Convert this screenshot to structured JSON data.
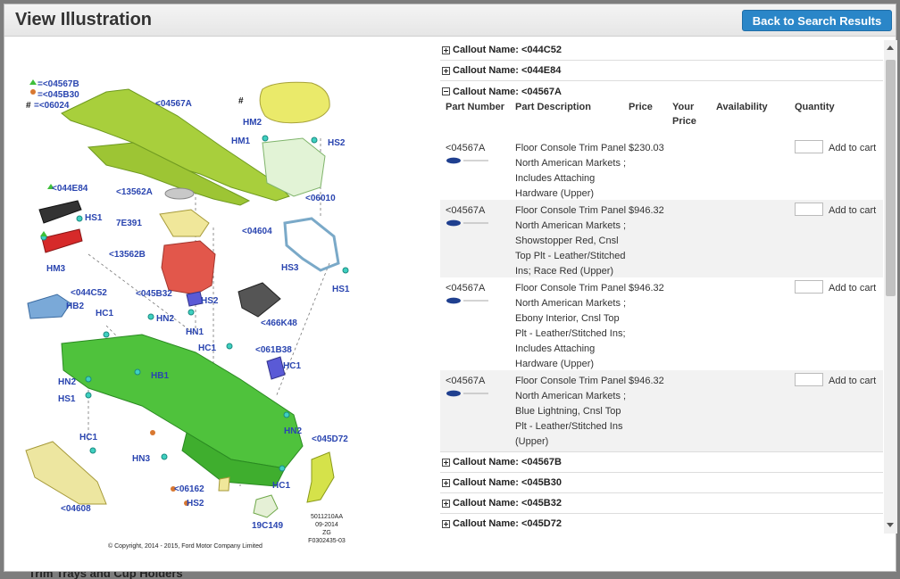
{
  "background_text": "Trim Trays and Cup Holders",
  "modal": {
    "title": "View Illustration",
    "back_button": "Back to Search Results"
  },
  "illustration": {
    "legend": [
      {
        "symbol": "triangle",
        "text": "=<04567B"
      },
      {
        "symbol": "circle",
        "text": "=<045B30"
      },
      {
        "symbol": "#",
        "text": "=<06024"
      }
    ],
    "labels": [
      "<04567A",
      "#",
      "HM2",
      "HM1",
      "HS2",
      "<06010",
      "<044E84",
      "HS1",
      "<13562A",
      "7E391",
      "<04604",
      "<13562B",
      "HM3",
      "<044C52",
      "HB2",
      "<045B32",
      "HS2",
      "HS3",
      "HS1",
      "HC1",
      "HN2",
      "HN1",
      "<466K48",
      "HC1",
      "<061B38",
      "HC1",
      "HB1",
      "HN2",
      "HS1",
      "HC1",
      "HN2",
      "<045D72",
      "HN3",
      "<06162",
      "HS2",
      "HC1",
      "<04608",
      "19C149"
    ],
    "ref_note": [
      "5011210AA",
      "09-2014",
      "ZG",
      "F0302435-03"
    ],
    "copyright": "© Copyright, 2014 - 2015, Ford Motor Company Limited"
  },
  "callouts_top": [
    {
      "label": "Callout Name: <044C52",
      "expanded": false
    },
    {
      "label": "Callout Name: <044E84",
      "expanded": false
    },
    {
      "label": "Callout Name: <04567A",
      "expanded": true
    }
  ],
  "table": {
    "headers": {
      "part_number": "Part Number",
      "part_description": "Part Description",
      "price": "Price",
      "your_price": "Your Price",
      "availability": "Availability",
      "quantity": "Quantity"
    },
    "rows": [
      {
        "part_number": "<04567A",
        "description": "Floor Console Trim Panel North American Markets ; Includes Attaching Hardware (Upper)",
        "price": "$230.03",
        "add": "Add to cart"
      },
      {
        "part_number": "<04567A",
        "description": "Floor Console Trim Panel North American Markets ; Showstopper Red, Cnsl Top Plt - Leather/Stitched Ins; Race Red (Upper)",
        "price": "$946.32",
        "add": "Add to cart"
      },
      {
        "part_number": "<04567A",
        "description": "Floor Console Trim Panel North American Markets ; Ebony Interior, Cnsl Top Plt - Leather/Stitched Ins; Includes Attaching Hardware (Upper)",
        "price": "$946.32",
        "add": "Add to cart"
      },
      {
        "part_number": "<04567A",
        "description": "Floor Console Trim Panel North American Markets ; Blue Lightning, Cnsl Top Plt - Leather/Stitched Ins (Upper)",
        "price": "$946.32",
        "add": "Add to cart"
      }
    ]
  },
  "callouts_bottom": [
    {
      "label": "Callout Name: <04567B",
      "expanded": false
    },
    {
      "label": "Callout Name: <045B30",
      "expanded": false
    },
    {
      "label": "Callout Name: <045B32",
      "expanded": false
    },
    {
      "label": "Callout Name: <045D72",
      "expanded": false
    }
  ],
  "colors": {
    "accent": "#2a86c8",
    "label_blue": "#2a45b0",
    "part_green": "#5bc84a"
  }
}
